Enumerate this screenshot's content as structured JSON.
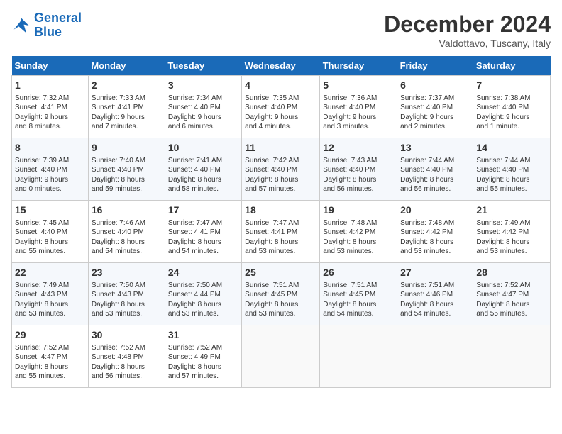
{
  "header": {
    "logo_line1": "General",
    "logo_line2": "Blue",
    "month": "December 2024",
    "location": "Valdottavo, Tuscany, Italy"
  },
  "days_of_week": [
    "Sunday",
    "Monday",
    "Tuesday",
    "Wednesday",
    "Thursday",
    "Friday",
    "Saturday"
  ],
  "weeks": [
    [
      {
        "day": "1",
        "info": "Sunrise: 7:32 AM\nSunset: 4:41 PM\nDaylight: 9 hours\nand 8 minutes."
      },
      {
        "day": "2",
        "info": "Sunrise: 7:33 AM\nSunset: 4:41 PM\nDaylight: 9 hours\nand 7 minutes."
      },
      {
        "day": "3",
        "info": "Sunrise: 7:34 AM\nSunset: 4:40 PM\nDaylight: 9 hours\nand 6 minutes."
      },
      {
        "day": "4",
        "info": "Sunrise: 7:35 AM\nSunset: 4:40 PM\nDaylight: 9 hours\nand 4 minutes."
      },
      {
        "day": "5",
        "info": "Sunrise: 7:36 AM\nSunset: 4:40 PM\nDaylight: 9 hours\nand 3 minutes."
      },
      {
        "day": "6",
        "info": "Sunrise: 7:37 AM\nSunset: 4:40 PM\nDaylight: 9 hours\nand 2 minutes."
      },
      {
        "day": "7",
        "info": "Sunrise: 7:38 AM\nSunset: 4:40 PM\nDaylight: 9 hours\nand 1 minute."
      }
    ],
    [
      {
        "day": "8",
        "info": "Sunrise: 7:39 AM\nSunset: 4:40 PM\nDaylight: 9 hours\nand 0 minutes."
      },
      {
        "day": "9",
        "info": "Sunrise: 7:40 AM\nSunset: 4:40 PM\nDaylight: 8 hours\nand 59 minutes."
      },
      {
        "day": "10",
        "info": "Sunrise: 7:41 AM\nSunset: 4:40 PM\nDaylight: 8 hours\nand 58 minutes."
      },
      {
        "day": "11",
        "info": "Sunrise: 7:42 AM\nSunset: 4:40 PM\nDaylight: 8 hours\nand 57 minutes."
      },
      {
        "day": "12",
        "info": "Sunrise: 7:43 AM\nSunset: 4:40 PM\nDaylight: 8 hours\nand 56 minutes."
      },
      {
        "day": "13",
        "info": "Sunrise: 7:44 AM\nSunset: 4:40 PM\nDaylight: 8 hours\nand 56 minutes."
      },
      {
        "day": "14",
        "info": "Sunrise: 7:44 AM\nSunset: 4:40 PM\nDaylight: 8 hours\nand 55 minutes."
      }
    ],
    [
      {
        "day": "15",
        "info": "Sunrise: 7:45 AM\nSunset: 4:40 PM\nDaylight: 8 hours\nand 55 minutes."
      },
      {
        "day": "16",
        "info": "Sunrise: 7:46 AM\nSunset: 4:40 PM\nDaylight: 8 hours\nand 54 minutes."
      },
      {
        "day": "17",
        "info": "Sunrise: 7:47 AM\nSunset: 4:41 PM\nDaylight: 8 hours\nand 54 minutes."
      },
      {
        "day": "18",
        "info": "Sunrise: 7:47 AM\nSunset: 4:41 PM\nDaylight: 8 hours\nand 53 minutes."
      },
      {
        "day": "19",
        "info": "Sunrise: 7:48 AM\nSunset: 4:42 PM\nDaylight: 8 hours\nand 53 minutes."
      },
      {
        "day": "20",
        "info": "Sunrise: 7:48 AM\nSunset: 4:42 PM\nDaylight: 8 hours\nand 53 minutes."
      },
      {
        "day": "21",
        "info": "Sunrise: 7:49 AM\nSunset: 4:42 PM\nDaylight: 8 hours\nand 53 minutes."
      }
    ],
    [
      {
        "day": "22",
        "info": "Sunrise: 7:49 AM\nSunset: 4:43 PM\nDaylight: 8 hours\nand 53 minutes."
      },
      {
        "day": "23",
        "info": "Sunrise: 7:50 AM\nSunset: 4:43 PM\nDaylight: 8 hours\nand 53 minutes."
      },
      {
        "day": "24",
        "info": "Sunrise: 7:50 AM\nSunset: 4:44 PM\nDaylight: 8 hours\nand 53 minutes."
      },
      {
        "day": "25",
        "info": "Sunrise: 7:51 AM\nSunset: 4:45 PM\nDaylight: 8 hours\nand 53 minutes."
      },
      {
        "day": "26",
        "info": "Sunrise: 7:51 AM\nSunset: 4:45 PM\nDaylight: 8 hours\nand 54 minutes."
      },
      {
        "day": "27",
        "info": "Sunrise: 7:51 AM\nSunset: 4:46 PM\nDaylight: 8 hours\nand 54 minutes."
      },
      {
        "day": "28",
        "info": "Sunrise: 7:52 AM\nSunset: 4:47 PM\nDaylight: 8 hours\nand 55 minutes."
      }
    ],
    [
      {
        "day": "29",
        "info": "Sunrise: 7:52 AM\nSunset: 4:47 PM\nDaylight: 8 hours\nand 55 minutes."
      },
      {
        "day": "30",
        "info": "Sunrise: 7:52 AM\nSunset: 4:48 PM\nDaylight: 8 hours\nand 56 minutes."
      },
      {
        "day": "31",
        "info": "Sunrise: 7:52 AM\nSunset: 4:49 PM\nDaylight: 8 hours\nand 57 minutes."
      },
      {
        "day": "",
        "info": ""
      },
      {
        "day": "",
        "info": ""
      },
      {
        "day": "",
        "info": ""
      },
      {
        "day": "",
        "info": ""
      }
    ]
  ]
}
